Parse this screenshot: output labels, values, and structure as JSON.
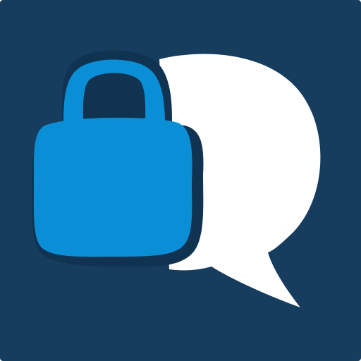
{
  "app_icon": {
    "icons": [
      "chat-bubble-icon",
      "padlock-icon"
    ],
    "colors": {
      "background": "#163C5E",
      "chat_bubble": "#FFFFFF",
      "padlock": "#0A8FD6",
      "padlock_shadow": "#0F3350"
    }
  }
}
